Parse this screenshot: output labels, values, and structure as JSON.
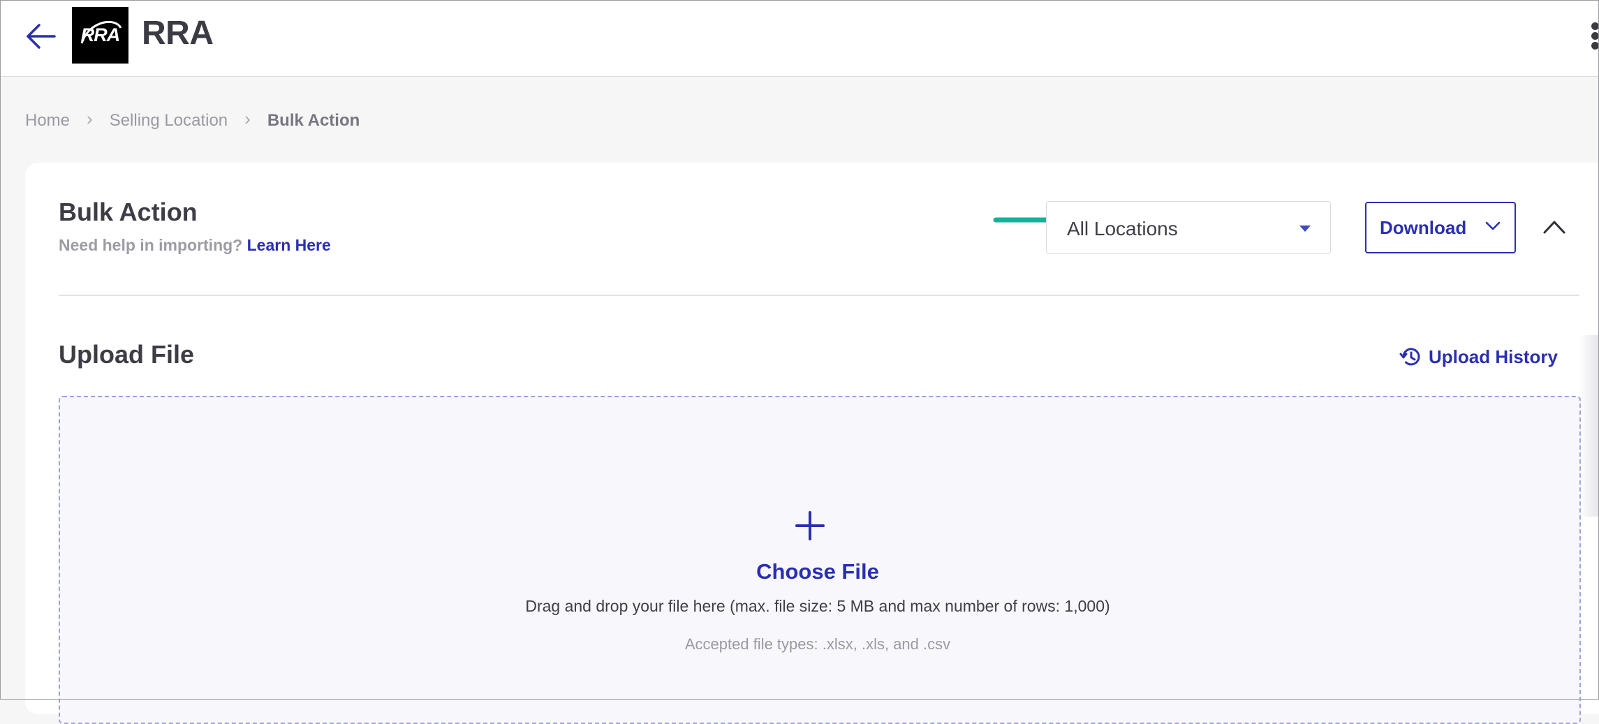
{
  "header": {
    "app_title": "RRA",
    "logo_text": "RRA",
    "back_icon": "arrow-left-icon",
    "menu_icon": "more-vertical-icon"
  },
  "breadcrumb": {
    "items": [
      "Home",
      "Selling Location",
      "Bulk Action"
    ],
    "separator": "›"
  },
  "bulk_action": {
    "title": "Bulk Action",
    "help_text": "Need help in importing?",
    "help_link": "Learn Here",
    "location_select": {
      "value": "All Locations"
    },
    "download_label": "Download",
    "collapse_icon": "chevron-up-icon"
  },
  "upload": {
    "title": "Upload File",
    "history_label": "Upload History",
    "history_icon": "history-icon",
    "choose_file_label": "Choose File",
    "drag_text": "Drag and drop your file here (max. file size: 5 MB and max number of rows: 1,000)",
    "accepted_text": "Accepted file types: .xlsx, .xls, and .csv"
  },
  "colors": {
    "accent": "#2a2fb0",
    "annotation_arrow": "#17b19a",
    "page_bg": "#f6f6f7",
    "dropzone_bg": "#f7f7fc"
  }
}
